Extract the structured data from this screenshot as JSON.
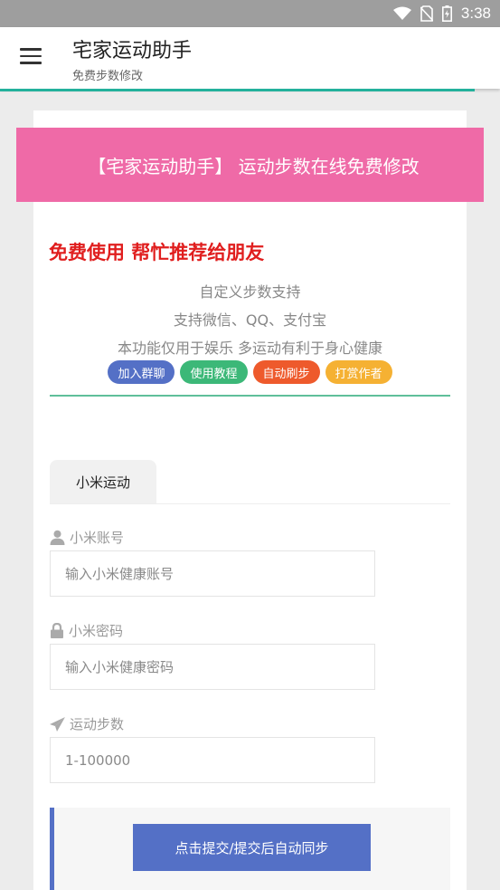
{
  "status_bar": {
    "time": "3:38"
  },
  "app_bar": {
    "title": "宅家运动助手",
    "subtitle": "免费步数修改"
  },
  "banner": {
    "text": "【宅家运动助手】 运动步数在线免费修改"
  },
  "intro": {
    "headline": "免费使用 帮忙推荐给朋友",
    "lines": [
      "自定义步数支持",
      "支持微信、QQ、支付宝",
      "本功能仅用于娱乐 多运动有利于身心健康"
    ],
    "badges": [
      {
        "label": "加入群聊",
        "color": "#5470c6"
      },
      {
        "label": "使用教程",
        "color": "#3cb878"
      },
      {
        "label": "自动刷步",
        "color": "#ee5a2c"
      },
      {
        "label": "打赏作者",
        "color": "#f5b133"
      }
    ]
  },
  "tabs": [
    {
      "label": "小米运动"
    }
  ],
  "form": {
    "account": {
      "label": "小米账号",
      "placeholder": "输入小米健康账号"
    },
    "password": {
      "label": "小米密码",
      "placeholder": "输入小米健康密码"
    },
    "steps": {
      "label": "运动步数",
      "placeholder": "1-100000"
    },
    "submit_label": "点击提交/提交后自动同步"
  },
  "colors": {
    "banner": "#ef6aa7",
    "accent": "#23b19c",
    "headline": "#e01e1e",
    "button": "#5470c6"
  }
}
